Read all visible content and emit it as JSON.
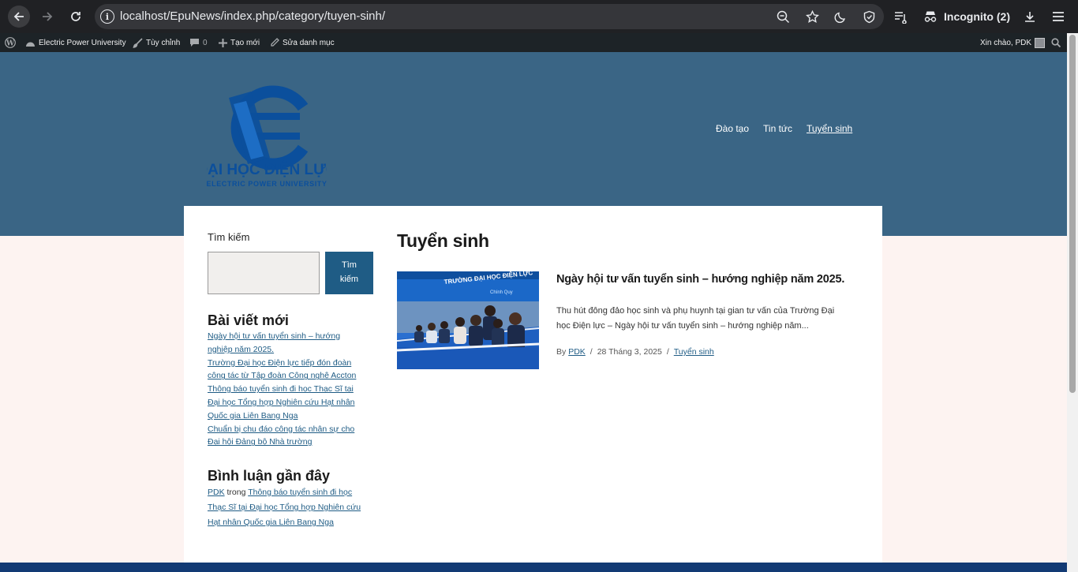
{
  "browser": {
    "url": "localhost/EpuNews/index.php/category/tuyen-sinh/",
    "incognito_label": "Incognito (2)"
  },
  "admin_bar": {
    "site_name": "Electric Power University",
    "customize": "Tùy chỉnh",
    "comments_count": "0",
    "new": "Tạo mới",
    "edit_category": "Sửa danh mục",
    "greeting": "Xin chào, PDK"
  },
  "header": {
    "logo_text": "ĐẠI HỌC ĐIỆN LỰC",
    "logo_subtext": "ELECTRIC POWER UNIVERSITY",
    "nav": [
      {
        "label": "Đào tạo"
      },
      {
        "label": "Tin tức"
      },
      {
        "label": "Tuyển sinh"
      }
    ]
  },
  "sidebar": {
    "search_label": "Tìm kiếm",
    "search_button_line1": "Tìm",
    "search_button_line2": "kiếm",
    "recent_posts_title": "Bài viết mới",
    "recent_posts": [
      {
        "line1": "Ngày hội tư vấn tuyển sinh – hướng",
        "line2": "nghiệp năm 2025."
      },
      {
        "line1": "Trường Đại học Điện lực tiếp đón đoàn",
        "line2": "công tác từ Tập đoàn Công nghệ Accton"
      },
      {
        "line1": "Thông báo tuyển sinh đi học Thạc Sĩ tại",
        "line2": "Đại học Tổng hợp Nghiên cứu Hạt nhân",
        "line3": "Quốc gia Liên Bang Nga"
      },
      {
        "line1": "Chuẩn bị chu đáo công tác nhân sự cho",
        "line2": "Đại hội Đảng bộ Nhà trường"
      }
    ],
    "recent_comments_title": "Bình luận gần đây",
    "comment": {
      "author": "PDK",
      "connector": "trong",
      "post_line1": "Thông báo tuyển sinh đi học",
      "post_line2": "Thạc Sĩ tại Đại học Tổng hợp Nghiên cứu",
      "post_line3": "Hạt nhân Quốc gia Liên Bang Nga"
    }
  },
  "main": {
    "page_title": "Tuyển sinh",
    "post": {
      "title": "Ngày hội tư vấn tuyển sinh – hướng nghiệp năm 2025.",
      "excerpt_line1": "Thu hút đông đảo học sinh và phụ huynh tại gian tư vấn của Trường Đại",
      "excerpt_line2": "học Điện lực – Ngày hội tư vấn tuyển sinh – hướng nghiệp năm...",
      "by": "By",
      "author": "PDK",
      "sep": "/",
      "date": "28 Tháng 3, 2025",
      "category": "Tuyển sinh",
      "thumb_banner_text": "TRƯỜNG ĐẠI HỌC ĐIỆN LỰC",
      "thumb_subtext": "Chính Quy"
    }
  }
}
